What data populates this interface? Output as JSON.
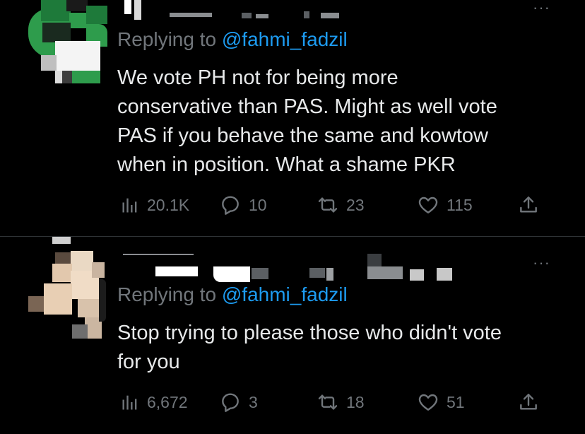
{
  "tweets": [
    {
      "replying_prefix": "Replying to",
      "replying_handle": "@fahmi_fadzil",
      "text_lines": [
        "We vote PH not for being more",
        "conservative than PAS. Might as well vote",
        "PAS if you behave the same and kowtow",
        "when in position. What a shame PKR"
      ],
      "more_label": "···",
      "views": "20.1K",
      "replies": "10",
      "retweets": "23",
      "likes": "115"
    },
    {
      "replying_prefix": "Replying to",
      "replying_handle": "@fahmi_fadzil",
      "text_lines": [
        "Stop trying to please those who didn't vote",
        "for you"
      ],
      "more_label": "···",
      "views": "6,672",
      "replies": "3",
      "retweets": "18",
      "likes": "51"
    }
  ],
  "colors": {
    "background": "#000000",
    "text": "#e7e9ea",
    "muted": "#71767b",
    "link": "#1d9bf0",
    "divider": "#2f3336"
  }
}
